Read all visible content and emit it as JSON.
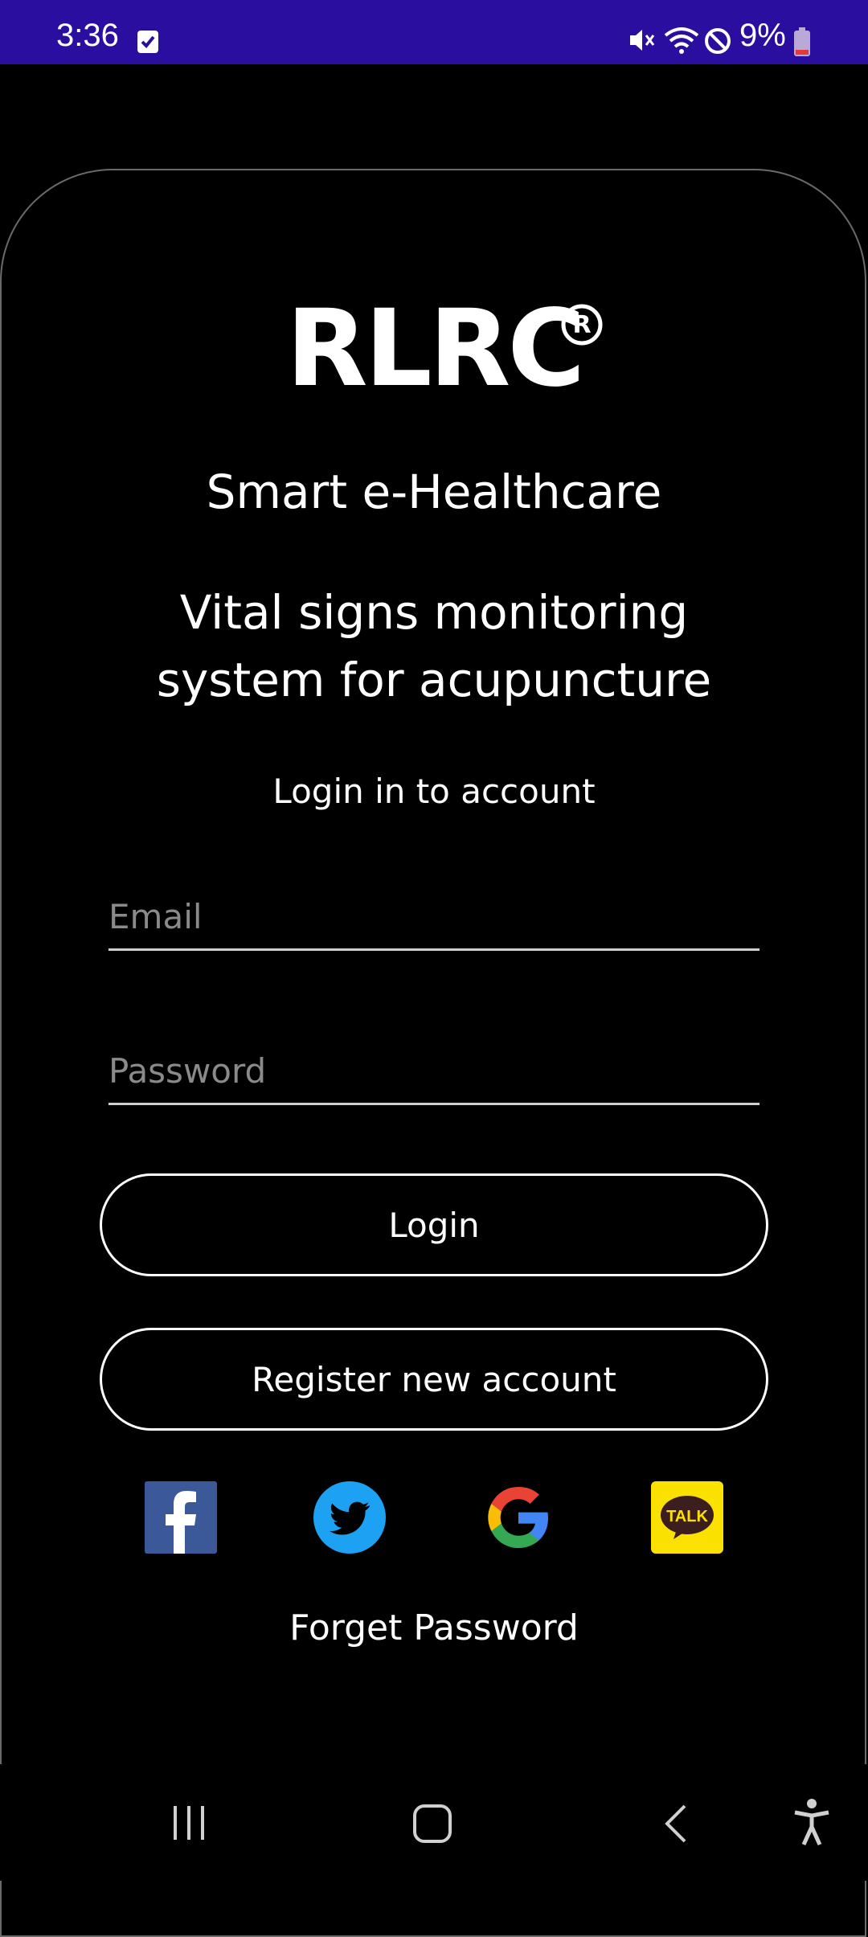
{
  "status_bar": {
    "time": "3:36",
    "battery": "9%",
    "icons": [
      "checkbox-notification-icon",
      "mute-icon",
      "wifi-icon",
      "do-not-disturb-icon",
      "battery-icon"
    ]
  },
  "app": {
    "logo_text": "RLRC",
    "subtitle": "Smart e-Healthcare",
    "tagline_line1": "Vital signs monitoring",
    "tagline_line2": "system for acupuncture",
    "login_prompt": "Login in to account"
  },
  "form": {
    "email_placeholder": "Email",
    "password_placeholder": "Password",
    "login_label": "Login",
    "register_label": "Register new account",
    "forget_label": "Forget Password"
  },
  "social": {
    "facebook_icon": "facebook-icon",
    "twitter_icon": "twitter-icon",
    "google_icon": "google-icon",
    "kakao_icon": "kakaotalk-icon",
    "kakao_text": "TALK"
  },
  "colors": {
    "status_bar": "#2a0ea0",
    "background": "#000000",
    "facebook": "#3b5998",
    "twitter": "#1da1f2",
    "kakao": "#fae100"
  },
  "nav_bar": {
    "icons": [
      "recent-apps-icon",
      "home-icon",
      "back-icon",
      "accessibility-icon"
    ]
  }
}
